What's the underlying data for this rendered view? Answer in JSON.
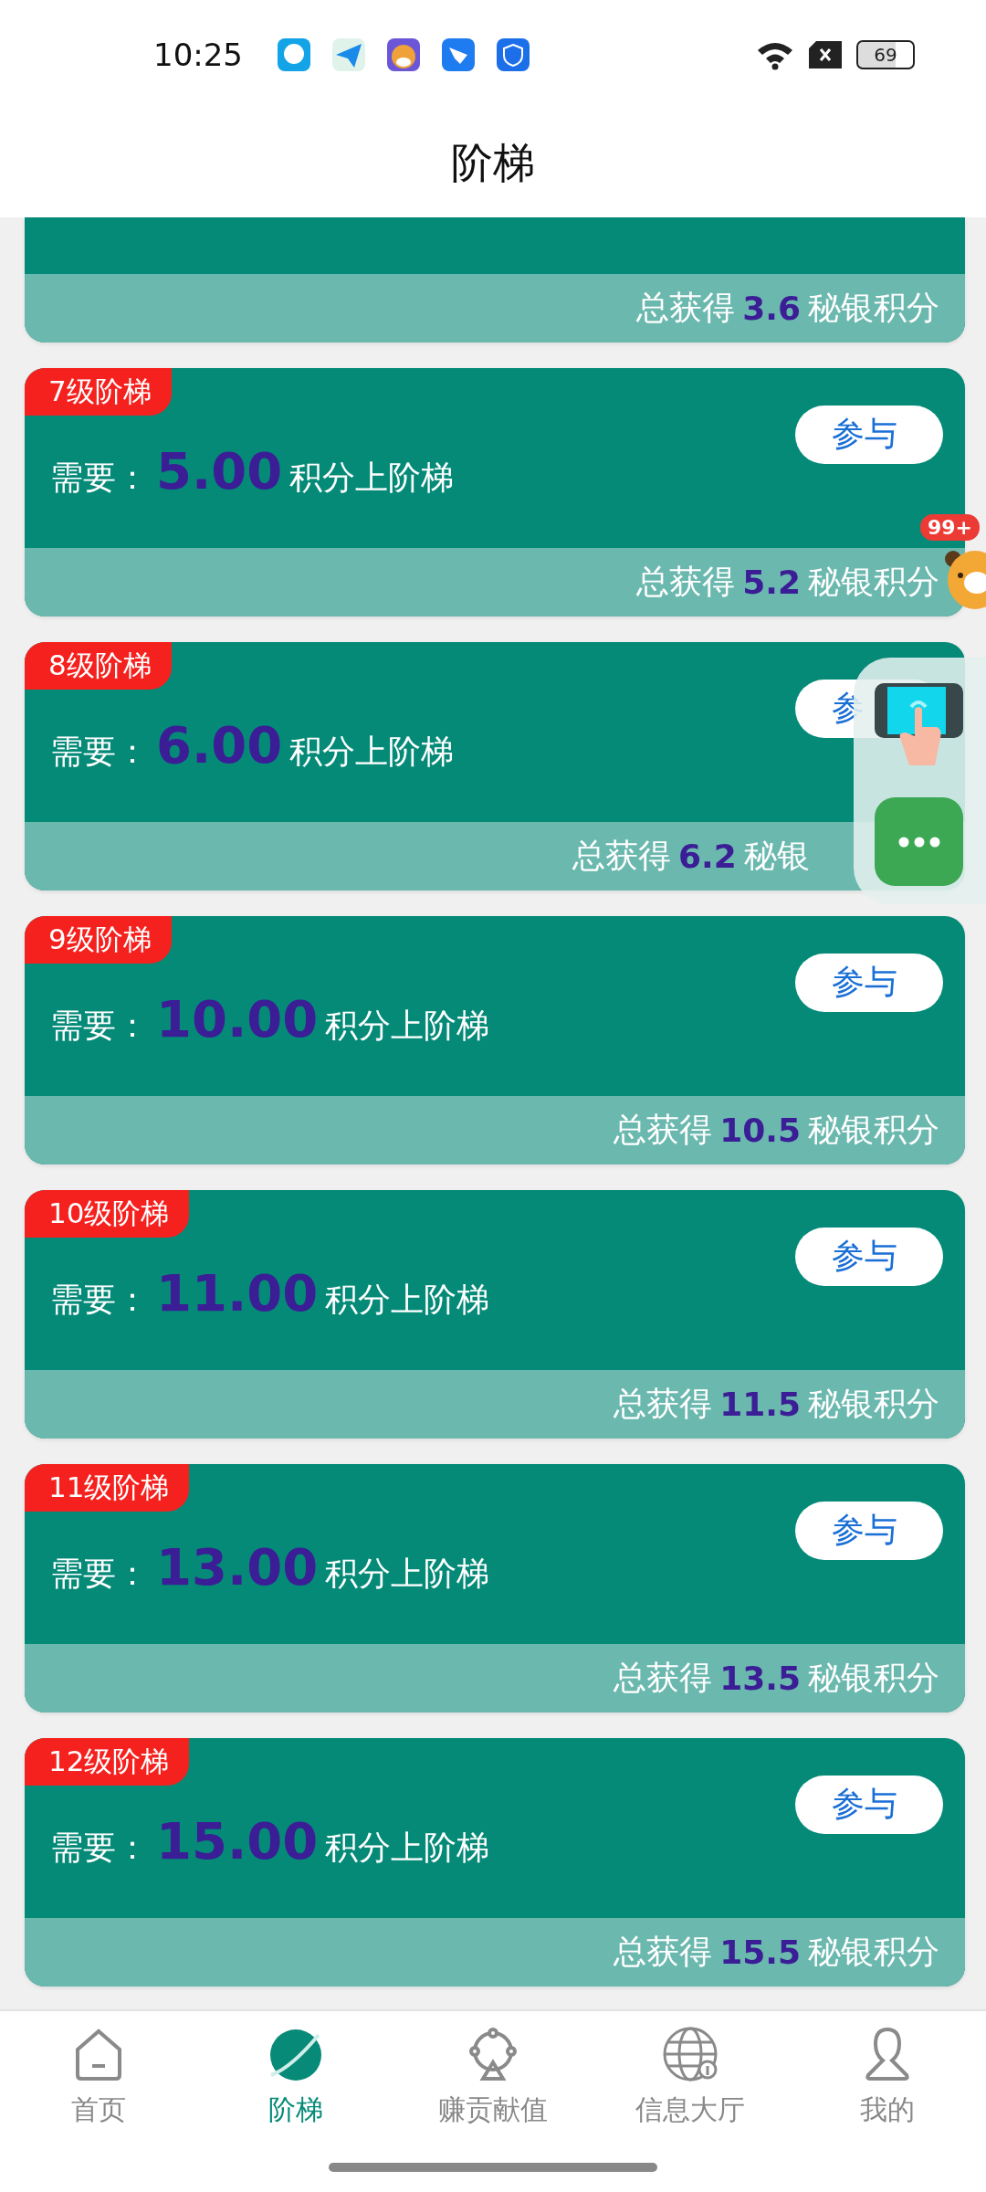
{
  "status_bar": {
    "time": "10:25",
    "battery": "69"
  },
  "header": {
    "title": "阶梯"
  },
  "tiers": [
    {
      "kind": "partial",
      "total_prefix": "总获得",
      "total": "3.6",
      "total_suffix": "秘银积分"
    },
    {
      "kind": "full",
      "badge": "7级阶梯",
      "need_label": "需要：",
      "amount": "5.00",
      "amount_suffix": "积分上阶梯",
      "button": "参与",
      "total_prefix": "总获得",
      "total": "5.2",
      "total_suffix": "秘银积分"
    },
    {
      "kind": "full",
      "badge": "8级阶梯",
      "need_label": "需要：",
      "amount": "6.00",
      "amount_suffix": "积分上阶梯",
      "button": "参",
      "total_prefix": "总获得",
      "total": "6.2",
      "total_suffix": "秘银"
    },
    {
      "kind": "full",
      "badge": "9级阶梯",
      "need_label": "需要：",
      "amount": "10.00",
      "amount_suffix": "积分上阶梯",
      "button": "参与",
      "total_prefix": "总获得",
      "total": "10.5",
      "total_suffix": "秘银积分"
    },
    {
      "kind": "full",
      "badge": "10级阶梯",
      "need_label": "需要：",
      "amount": "11.00",
      "amount_suffix": "积分上阶梯",
      "button": "参与",
      "total_prefix": "总获得",
      "total": "11.5",
      "total_suffix": "秘银积分"
    },
    {
      "kind": "full",
      "badge": "11级阶梯",
      "need_label": "需要：",
      "amount": "13.00",
      "amount_suffix": "积分上阶梯",
      "button": "参与",
      "total_prefix": "总获得",
      "total": "13.5",
      "total_suffix": "秘银积分"
    },
    {
      "kind": "full",
      "badge": "12级阶梯",
      "need_label": "需要：",
      "amount": "15.00",
      "amount_suffix": "积分上阶梯",
      "button": "参与",
      "total_prefix": "总获得",
      "total": "15.5",
      "total_suffix": "秘银积分"
    }
  ],
  "floating": {
    "badge": "99+"
  },
  "tabs": [
    {
      "kind": "home",
      "label": "首页",
      "selected": false
    },
    {
      "kind": "planet",
      "label": "阶梯",
      "selected": true
    },
    {
      "kind": "wheel",
      "label": "赚贡献值",
      "selected": false
    },
    {
      "kind": "globe",
      "label": "信息大厅",
      "selected": false
    },
    {
      "kind": "person",
      "label": "我的",
      "selected": false
    }
  ]
}
